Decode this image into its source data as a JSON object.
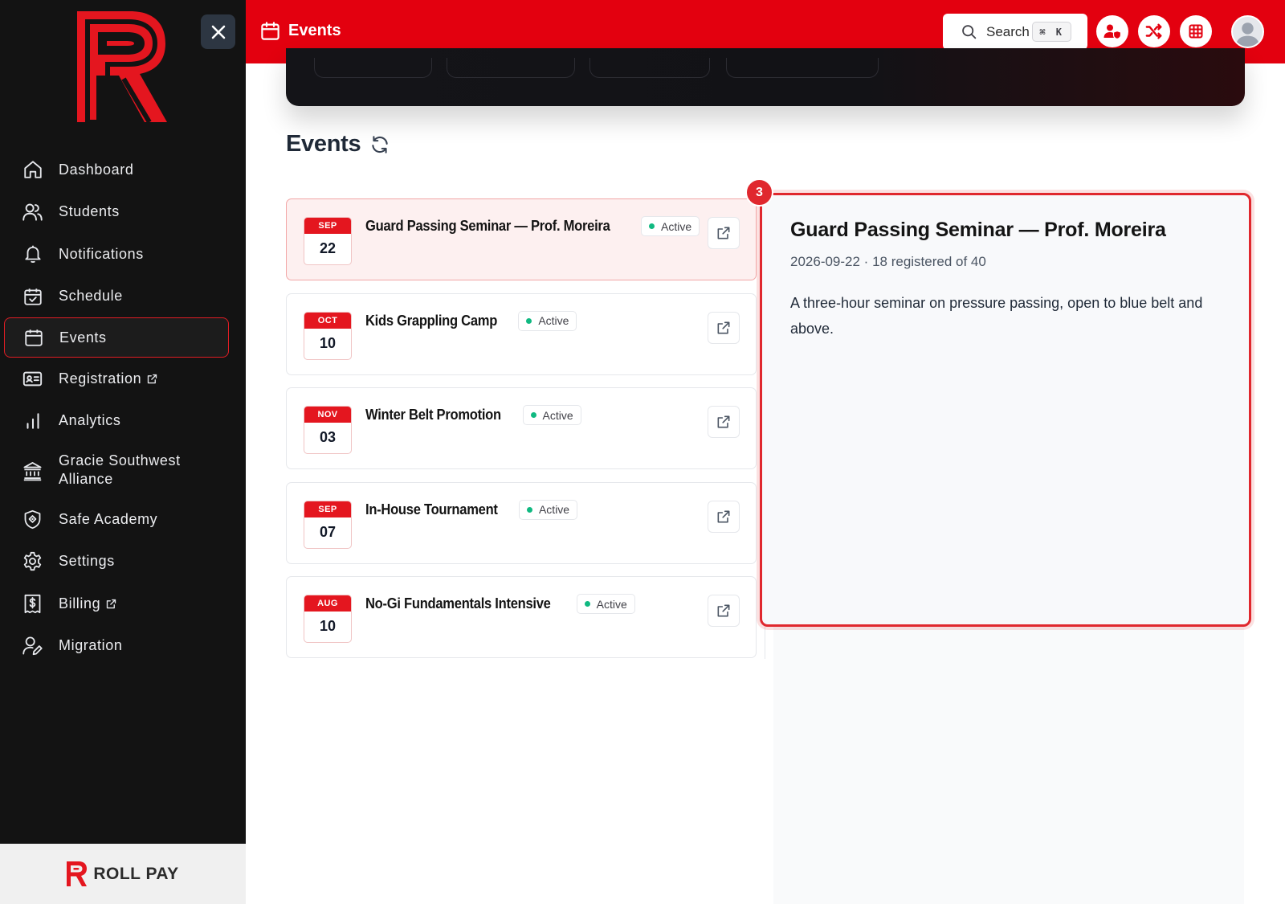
{
  "sidebar": {
    "close_icon": "close-icon",
    "items": [
      {
        "label": "Dashboard",
        "icon": "home-icon"
      },
      {
        "label": "Students",
        "icon": "users-icon"
      },
      {
        "label": "Notifications",
        "icon": "bell-icon"
      },
      {
        "label": "Schedule",
        "icon": "calendar-check-icon"
      },
      {
        "label": "Events",
        "icon": "calendar-icon",
        "active": true
      },
      {
        "label": "Registration",
        "icon": "id-card-icon",
        "external": true
      },
      {
        "label": "Analytics",
        "icon": "bar-chart-icon"
      },
      {
        "label": "Gracie Southwest Alliance",
        "icon": "bank-icon"
      },
      {
        "label": "Safe Academy",
        "icon": "shield-icon"
      },
      {
        "label": "Settings",
        "icon": "gear-icon"
      },
      {
        "label": "Billing",
        "icon": "billing-icon",
        "external": true
      },
      {
        "label": "Migration",
        "icon": "user-edit-icon"
      }
    ],
    "footer_brand": "ROLL PAY"
  },
  "topbar": {
    "title": "Events",
    "search_label": "Search",
    "search_shortcut": "⌘ K",
    "accent": "#e3000f"
  },
  "main": {
    "section_title": "Events",
    "events": [
      {
        "month": "SEP",
        "day": "22",
        "title": "Guard Passing Seminar — Prof. Moreira",
        "status": "Active",
        "selected": true
      },
      {
        "month": "OCT",
        "day": "10",
        "title": "Kids Grappling Camp",
        "status": "Active"
      },
      {
        "month": "NOV",
        "day": "03",
        "title": "Winter Belt Promotion",
        "status": "Active"
      },
      {
        "month": "SEP",
        "day": "07",
        "title": "In-House Tournament",
        "status": "Active"
      },
      {
        "month": "AUG",
        "day": "10",
        "title": "No-Gi Fundamentals Intensive",
        "status": "Active"
      }
    ]
  },
  "detail": {
    "badge": "3",
    "title": "Guard Passing Seminar — Prof. Moreira",
    "meta": "2026-09-22 · 18 registered of 40",
    "description": "A three-hour seminar on pressure passing, open to blue belt and above."
  }
}
